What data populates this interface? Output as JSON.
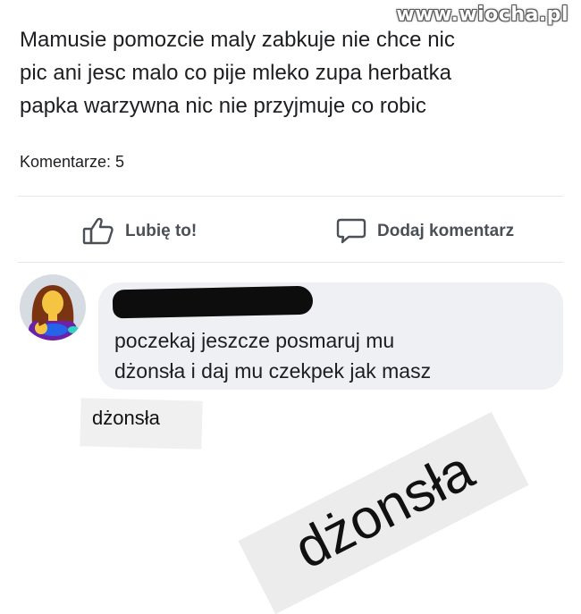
{
  "watermark": "www.wiocha.pl",
  "post": {
    "lines": [
      "Mamusie pomozcie maly zabkuje  nie chce nic",
      "pic ani jesc malo co pije mleko zupa herbatka",
      "papka warzywna nic nie przyjmuje co robic"
    ]
  },
  "comments_count": "Komentarze: 5",
  "actions": {
    "like": "Lubię to!",
    "comment": "Dodaj komentarz"
  },
  "comment": {
    "avatar_icon": "woman-feeding-baby-icon",
    "lines": [
      "poczekaj jeszcze posmaruj mu",
      "dżonsła i daj mu czekpek jak masz"
    ]
  },
  "stickers": {
    "small": "dżonsła",
    "large": "dżonsła"
  },
  "colors": {
    "action_text": "#4b4f56",
    "bubble": "#eef0f3",
    "avatar_bg": "#d7dce3"
  }
}
